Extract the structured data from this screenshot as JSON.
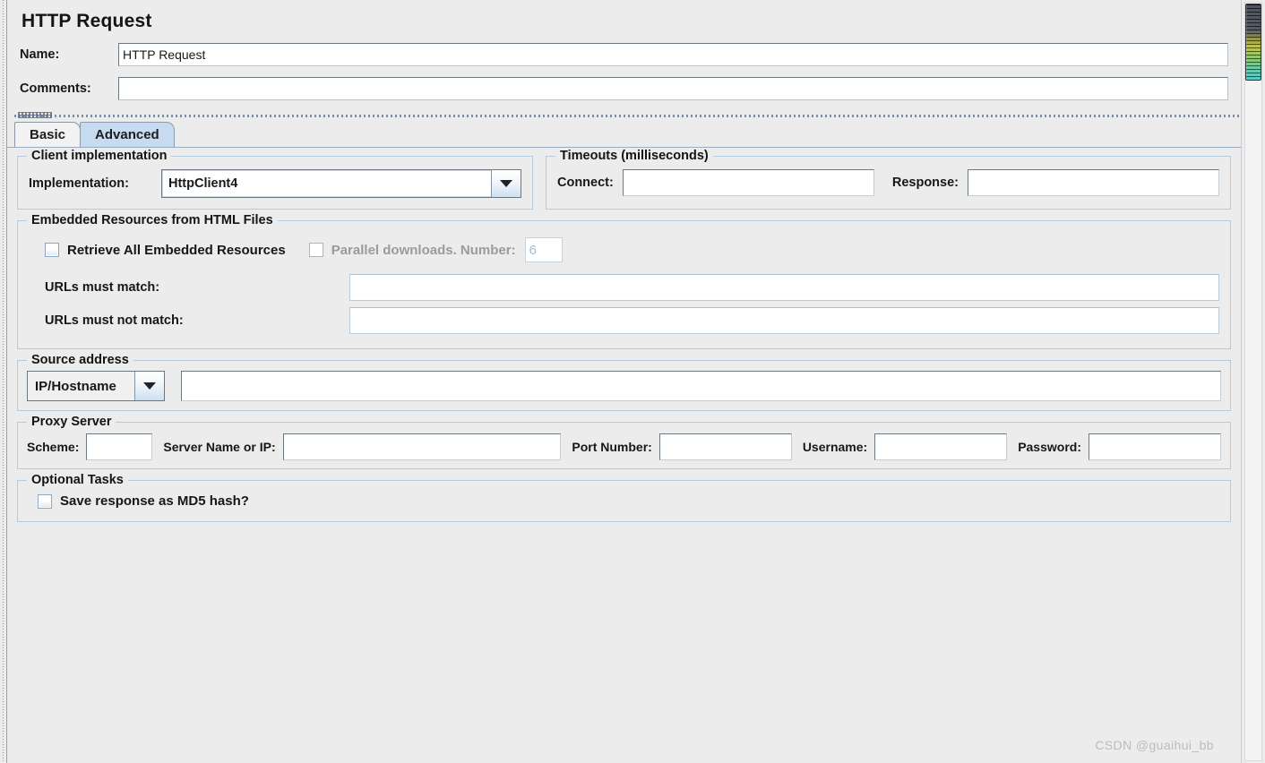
{
  "header": {
    "title": "HTTP Request",
    "name_label": "Name:",
    "name_value": "HTTP Request",
    "comments_label": "Comments:",
    "comments_value": ""
  },
  "tabs": [
    {
      "label": "Basic",
      "selected": false
    },
    {
      "label": "Advanced",
      "selected": true
    }
  ],
  "client_implementation": {
    "legend": "Client implementation",
    "label": "Implementation:",
    "value": "HttpClient4",
    "dropdown_icon": "chevron-down-icon"
  },
  "timeouts": {
    "legend": "Timeouts (milliseconds)",
    "connect_label": "Connect:",
    "connect_value": "",
    "response_label": "Response:",
    "response_value": ""
  },
  "embedded_resources": {
    "legend": "Embedded Resources from HTML Files",
    "retrieve_label": "Retrieve All Embedded Resources",
    "retrieve_checked": false,
    "parallel_label": "Parallel downloads. Number:",
    "parallel_checked": false,
    "parallel_disabled": true,
    "parallel_number": "6",
    "urls_match_label": "URLs must match:",
    "urls_match_value": "",
    "urls_not_match_label": "URLs must not match:",
    "urls_not_match_value": ""
  },
  "source_address": {
    "legend": "Source address",
    "type_value": "IP/Hostname",
    "dropdown_icon": "chevron-down-icon",
    "address_value": ""
  },
  "proxy_server": {
    "legend": "Proxy Server",
    "scheme_label": "Scheme:",
    "scheme_value": "",
    "server_label": "Server Name or IP:",
    "server_value": "",
    "port_label": "Port Number:",
    "port_value": "",
    "username_label": "Username:",
    "username_value": "",
    "password_label": "Password:",
    "password_value": ""
  },
  "optional_tasks": {
    "legend": "Optional Tasks",
    "md5_label": "Save response as MD5 hash?",
    "md5_checked": false
  },
  "watermark": "CSDN @guaihui_bb",
  "colors": {
    "panel_bg": "#ececed",
    "tab_selected": "#c6dbef",
    "group_border": "#b6cade",
    "field_border": "#6c7880",
    "disabled_text": "#9b9b9b"
  }
}
